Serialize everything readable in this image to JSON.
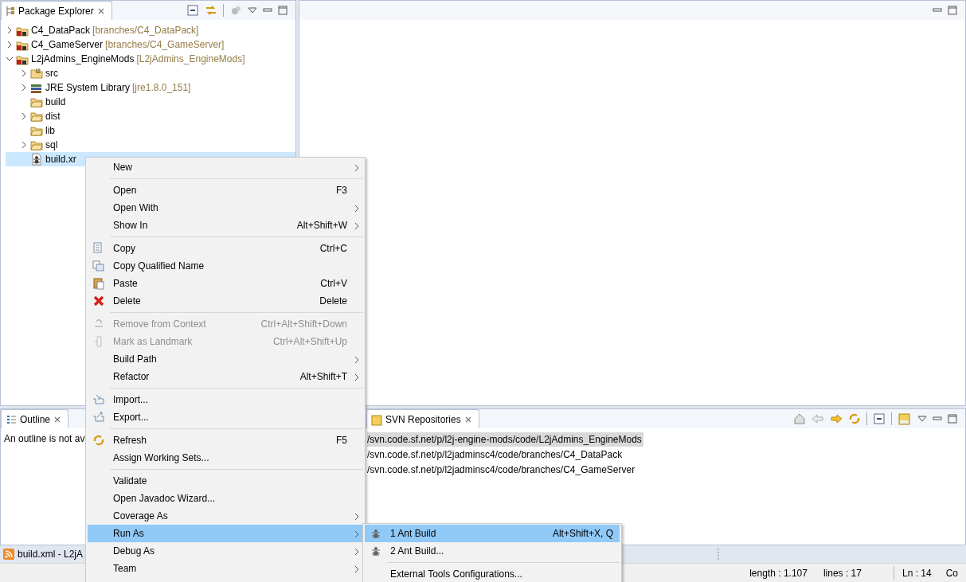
{
  "package_explorer": {
    "title": "Package Explorer",
    "tree": [
      {
        "label": "C4_DataPack",
        "decoration": "[branches/C4_DataPack]",
        "kind": "project",
        "expanded": false,
        "selected": false
      },
      {
        "label": "C4_GameServer",
        "decoration": "[branches/C4_GameServer]",
        "kind": "project",
        "expanded": false,
        "selected": false
      },
      {
        "label": "L2jAdmins_EngineMods",
        "decoration": "[L2jAdmins_EngineMods]",
        "kind": "project",
        "expanded": true,
        "selected": false,
        "children": [
          {
            "label": "src",
            "kind": "source-folder",
            "expanded": false,
            "selected": false
          },
          {
            "label": "JRE System Library",
            "decoration": "[jre1.8.0_151]",
            "kind": "library",
            "expanded": false,
            "selected": false
          },
          {
            "label": "build",
            "kind": "folder",
            "selected": false
          },
          {
            "label": "dist",
            "kind": "folder",
            "expanded": false,
            "selected": false
          },
          {
            "label": "lib",
            "kind": "folder",
            "selected": false
          },
          {
            "label": "sql",
            "kind": "folder",
            "expanded": false,
            "selected": false
          },
          {
            "label": "build.xr",
            "kind": "ant-file",
            "selected": true
          }
        ]
      }
    ]
  },
  "outline": {
    "title": "Outline",
    "message": "An outline is not av"
  },
  "svn_repositories": {
    "title": "SVN Repositories",
    "rows": [
      {
        "label": "/svn.code.sf.net/p/l2j-engine-mods/code/L2jAdmins_EngineMods",
        "selected": true
      },
      {
        "label": "/svn.code.sf.net/p/l2jadminsc4/code/branches/C4_DataPack",
        "selected": false
      },
      {
        "label": "/svn.code.sf.net/p/l2jadminsc4/code/branches/C4_GameServer",
        "selected": false
      }
    ]
  },
  "minimized_editor": {
    "label": "build.xml - L2jA"
  },
  "status_bar": {
    "length": "length : 1.107",
    "lines": "lines : 17",
    "line": "Ln : 14",
    "column": "Co"
  },
  "context_menu": [
    {
      "kind": "item",
      "label": "New",
      "submenu": true,
      "disabled": false,
      "selected": false
    },
    {
      "kind": "separator"
    },
    {
      "kind": "item",
      "label": "Open",
      "shortcut": "F3",
      "submenu": false,
      "disabled": false,
      "selected": false
    },
    {
      "kind": "item",
      "label": "Open With",
      "submenu": true,
      "disabled": false,
      "selected": false
    },
    {
      "kind": "item",
      "label": "Show In",
      "shortcut": "Alt+Shift+W",
      "submenu": true,
      "disabled": false,
      "selected": false
    },
    {
      "kind": "separator"
    },
    {
      "kind": "item",
      "label": "Copy",
      "shortcut": "Ctrl+C",
      "submenu": false,
      "disabled": false,
      "selected": false
    },
    {
      "kind": "item",
      "label": "Copy Qualified Name",
      "submenu": false,
      "disabled": false,
      "selected": false
    },
    {
      "kind": "item",
      "label": "Paste",
      "shortcut": "Ctrl+V",
      "submenu": false,
      "disabled": false,
      "selected": false
    },
    {
      "kind": "item",
      "label": "Delete",
      "shortcut": "Delete",
      "submenu": false,
      "disabled": false,
      "selected": false
    },
    {
      "kind": "separator"
    },
    {
      "kind": "item",
      "label": "Remove from Context",
      "shortcut": "Ctrl+Alt+Shift+Down",
      "submenu": false,
      "disabled": true,
      "selected": false
    },
    {
      "kind": "item",
      "label": "Mark as Landmark",
      "shortcut": "Ctrl+Alt+Shift+Up",
      "submenu": false,
      "disabled": true,
      "selected": false
    },
    {
      "kind": "item",
      "label": "Build Path",
      "submenu": true,
      "disabled": false,
      "selected": false
    },
    {
      "kind": "item",
      "label": "Refactor",
      "shortcut": "Alt+Shift+T",
      "submenu": true,
      "disabled": false,
      "selected": false
    },
    {
      "kind": "separator"
    },
    {
      "kind": "item",
      "label": "Import...",
      "submenu": false,
      "disabled": false,
      "selected": false
    },
    {
      "kind": "item",
      "label": "Export...",
      "submenu": false,
      "disabled": false,
      "selected": false
    },
    {
      "kind": "separator"
    },
    {
      "kind": "item",
      "label": "Refresh",
      "shortcut": "F5",
      "submenu": false,
      "disabled": false,
      "selected": false
    },
    {
      "kind": "item",
      "label": "Assign Working Sets...",
      "submenu": false,
      "disabled": false,
      "selected": false
    },
    {
      "kind": "separator"
    },
    {
      "kind": "item",
      "label": "Validate",
      "submenu": false,
      "disabled": false,
      "selected": false
    },
    {
      "kind": "item",
      "label": "Open Javadoc Wizard...",
      "submenu": false,
      "disabled": false,
      "selected": false
    },
    {
      "kind": "item",
      "label": "Coverage As",
      "submenu": true,
      "disabled": false,
      "selected": false
    },
    {
      "kind": "item",
      "label": "Run As",
      "submenu": true,
      "disabled": false,
      "selected": true
    },
    {
      "kind": "item",
      "label": "Debug As",
      "submenu": true,
      "disabled": false,
      "selected": false
    },
    {
      "kind": "item",
      "label": "Team",
      "submenu": true,
      "disabled": false,
      "selected": false
    }
  ],
  "run_as_submenu": [
    {
      "kind": "item",
      "label": "1 Ant Build",
      "shortcut": "Alt+Shift+X, Q",
      "selected": true
    },
    {
      "kind": "item",
      "label": "2 Ant Build...",
      "selected": false
    },
    {
      "kind": "separator"
    },
    {
      "kind": "item",
      "label": "External Tools Configurations...",
      "selected": false
    }
  ]
}
